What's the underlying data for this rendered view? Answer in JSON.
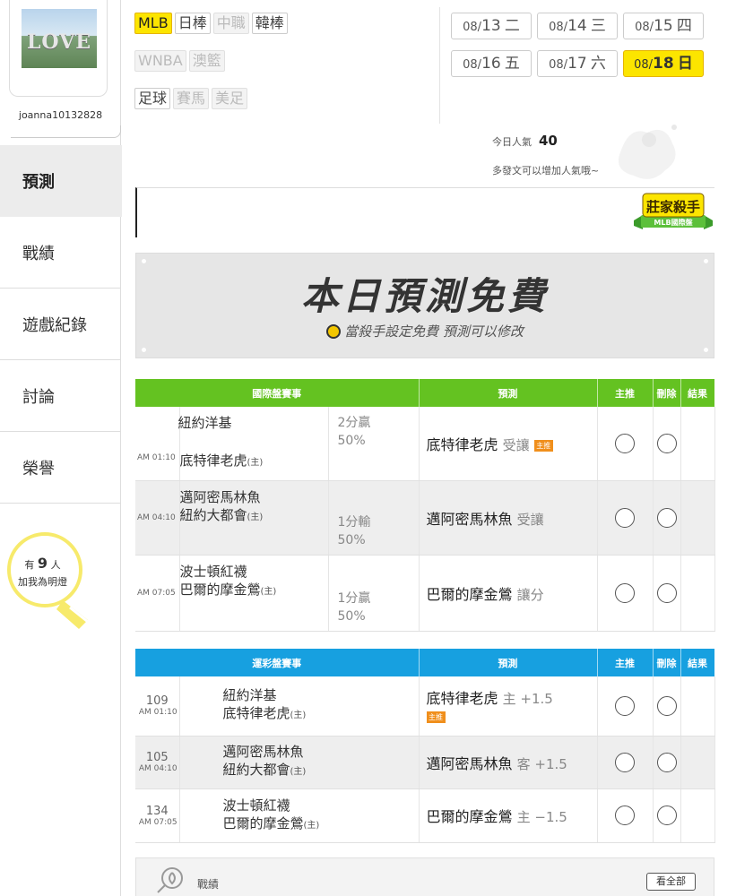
{
  "user": {
    "name": "joanna10132828",
    "avatar_text": "LOVE",
    "fans_prefix": "有",
    "fans_count": "9",
    "fans_unit": "人",
    "fans_suffix": "加我為明燈"
  },
  "nav": [
    {
      "label": "預測",
      "active": true
    },
    {
      "label": "戰績"
    },
    {
      "label": "遊戲紀錄"
    },
    {
      "label": "討論"
    },
    {
      "label": "榮譽"
    }
  ],
  "filters": {
    "row1": [
      {
        "label": "MLB",
        "state": "active"
      },
      {
        "label": "日棒",
        "state": "normal"
      },
      {
        "label": "中職",
        "state": "disabled"
      },
      {
        "label": "韓棒",
        "state": "normal"
      }
    ],
    "row2": [
      {
        "label": "WNBA",
        "state": "disabled"
      },
      {
        "label": "澳籃",
        "state": "disabled"
      }
    ],
    "row3": [
      {
        "label": "足球",
        "state": "normal"
      },
      {
        "label": "賽馬",
        "state": "disabled"
      },
      {
        "label": "美足",
        "state": "disabled"
      }
    ]
  },
  "dates": [
    {
      "md": "08/",
      "d": "13",
      "w": "二"
    },
    {
      "md": "08/",
      "d": "14",
      "w": "三"
    },
    {
      "md": "08/",
      "d": "15",
      "w": "四"
    },
    {
      "md": "08/",
      "d": "16",
      "w": "五"
    },
    {
      "md": "08/",
      "d": "17",
      "w": "六"
    },
    {
      "md": "08/",
      "d": "18",
      "w": "日",
      "active": true
    }
  ],
  "popularity": {
    "label": "今日人氣",
    "value": "40",
    "hint": "多發文可以增加人氣哦~"
  },
  "badge": {
    "title": "莊家殺手",
    "subtitle": "MLB國際盤"
  },
  "banner": {
    "title": "本日預測免費",
    "subtitle": "當殺手設定免費 預測可以修改"
  },
  "intl_table": {
    "headers": [
      "國際盤賽事",
      "預測",
      "主推",
      "刪除",
      "結果"
    ],
    "rows": [
      {
        "time": "AM 01:10",
        "team1": "紐約洋基",
        "team2": "底特律老虎",
        "host": "(主)",
        "odds_top": "2分贏",
        "odds_pct": "50%",
        "pick": "底特律老虎",
        "pick_note": "受讓",
        "tag": "主推"
      },
      {
        "time": "AM 04:10",
        "team1": "邁阿密馬林魚",
        "team2": "紐約大都會",
        "host": "(主)",
        "odds_top": "1分輸",
        "odds_pct": "50%",
        "pick": "邁阿密馬林魚",
        "pick_note": "受讓",
        "tag": ""
      },
      {
        "time": "AM 07:05",
        "team1": "波士頓紅襪",
        "team2": "巴爾的摩金鶯",
        "host": "(主)",
        "odds_top": "1分贏",
        "odds_pct": "50%",
        "pick": "巴爾的摩金鶯",
        "pick_note": "讓分",
        "tag": ""
      }
    ]
  },
  "sport_table": {
    "headers": [
      "運彩盤賽事",
      "預測",
      "主推",
      "刪除",
      "結果"
    ],
    "rows": [
      {
        "num": "109",
        "time": "AM 01:10",
        "team1": "紐約洋基",
        "team2": "底特律老虎",
        "host": "(主)",
        "pick": "底特律老虎",
        "pick_note": "主 +1.5",
        "tag": "主推"
      },
      {
        "num": "105",
        "time": "AM 04:10",
        "team1": "邁阿密馬林魚",
        "team2": "紐約大都會",
        "host": "(主)",
        "pick": "邁阿密馬林魚",
        "pick_note": "客 +1.5",
        "tag": ""
      },
      {
        "num": "134",
        "time": "AM 07:05",
        "team1": "波士頓紅襪",
        "team2": "巴爾的摩金鶯",
        "host": "(主)",
        "pick": "巴爾的摩金鶯",
        "pick_note": "主 −1.5",
        "tag": ""
      }
    ]
  },
  "record": {
    "label": "戰績",
    "button": "看全部"
  },
  "colors": {
    "accent_yellow": "#fce500",
    "intl_green": "#64c221",
    "sport_blue": "#17a0e0",
    "tag_orange": "#f08f1c"
  }
}
